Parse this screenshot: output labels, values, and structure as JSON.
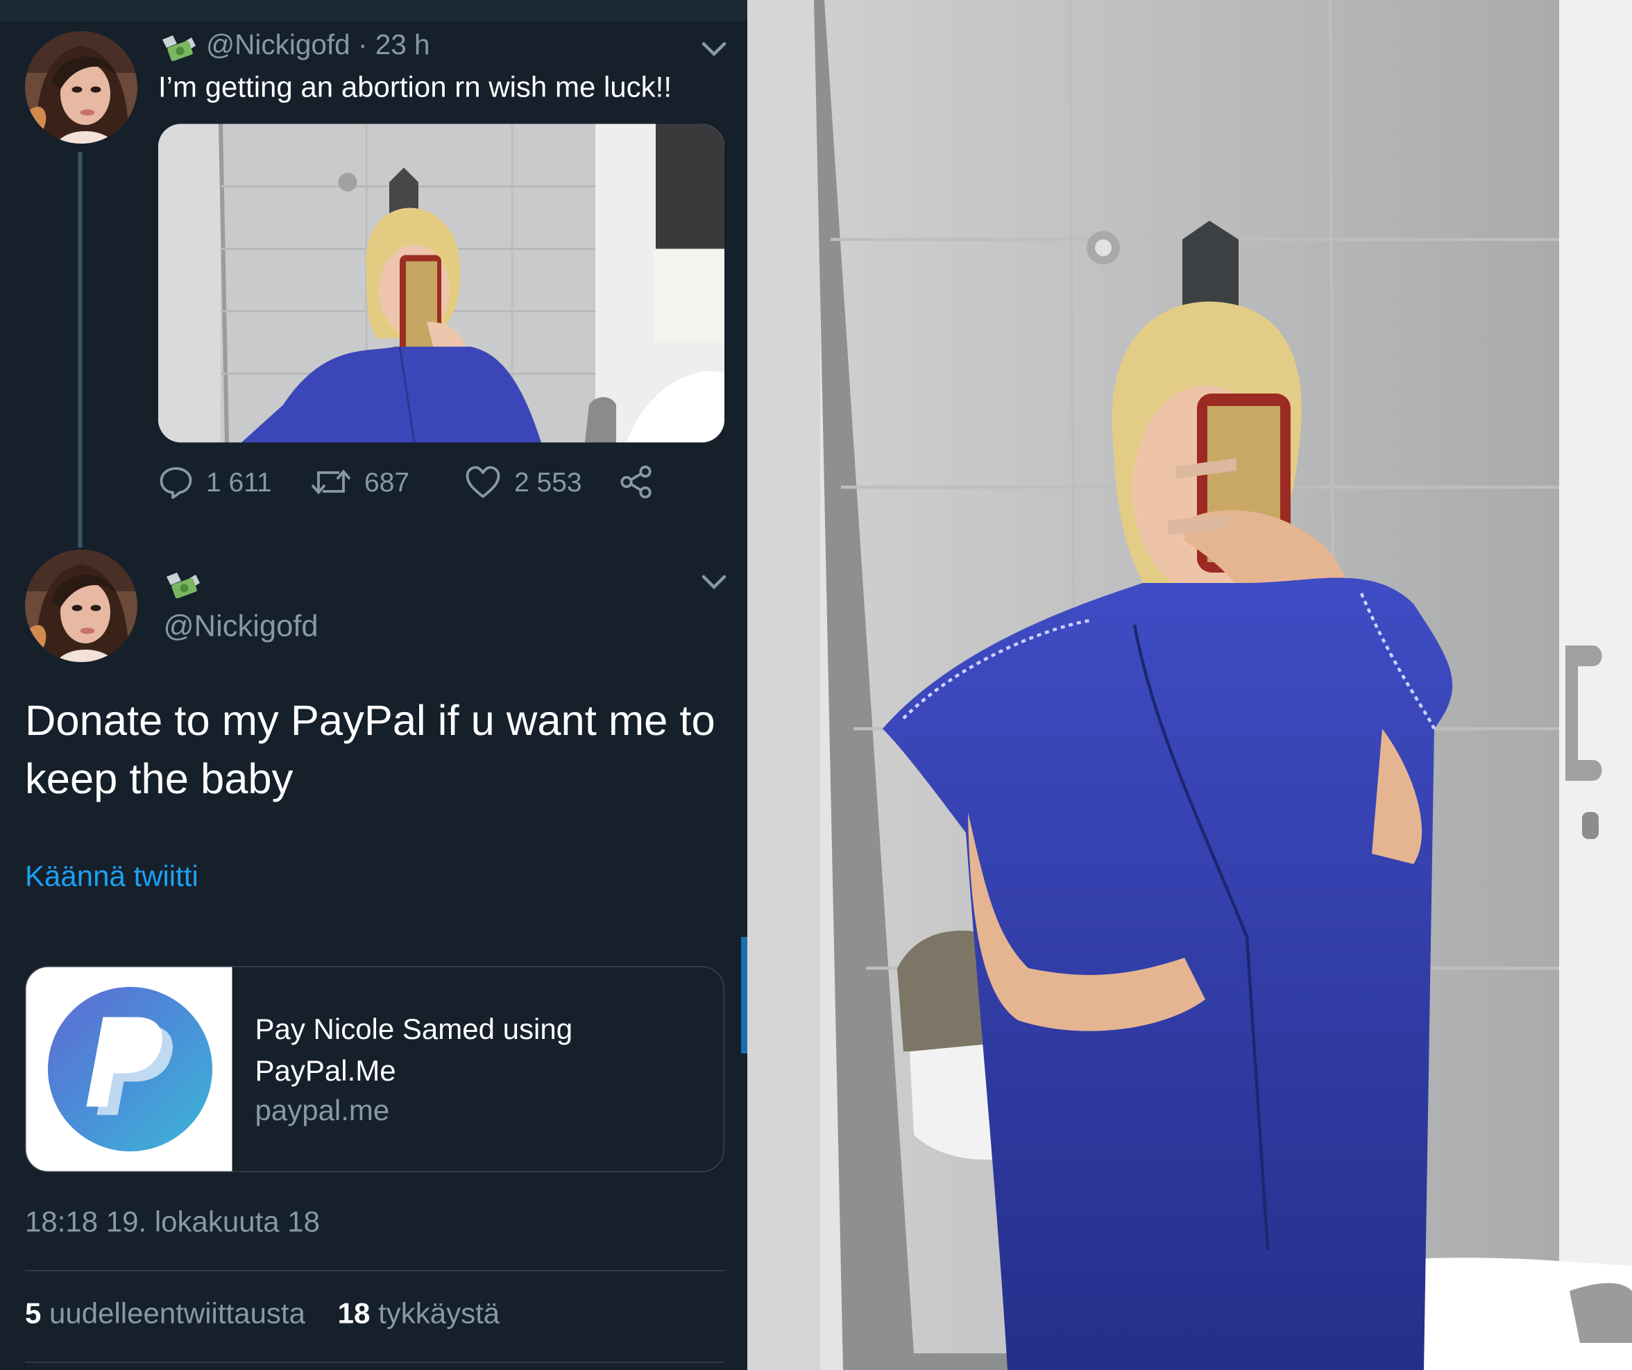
{
  "tweet1": {
    "handle": "@Nickigofd",
    "time": "· 23 h",
    "text": "I’m getting an abortion rn wish me luck!!",
    "counts": {
      "replies": "1 611",
      "retweets": "687",
      "likes": "2 553"
    }
  },
  "tweet2": {
    "handle": "@Nickigofd",
    "text": "Donate to my PayPal if u want me to keep the baby",
    "translate_link": "Käännä twiitti",
    "card": {
      "title": "Pay Nicole Samed using PayPal.Me",
      "domain": "paypal.me"
    },
    "timestamp": "18:18 19. lokakuuta 18",
    "retweets_count": "5",
    "retweets_label": "uudelleentwiittausta",
    "likes_count": "18",
    "likes_label": "tykkäystä"
  },
  "icons": {
    "reply": "reply-icon",
    "retweet": "retweet-icon",
    "like": "heart-icon",
    "share": "share-icon",
    "menu": "chevron-down-icon",
    "emoji": "money-with-wings-icon",
    "card_logo": "paypal-logo-icon"
  },
  "colors": {
    "background": "#15202b",
    "text_primary": "#ffffff",
    "text_secondary": "#8899a6",
    "link": "#1da1f2",
    "divider": "#38444d"
  }
}
